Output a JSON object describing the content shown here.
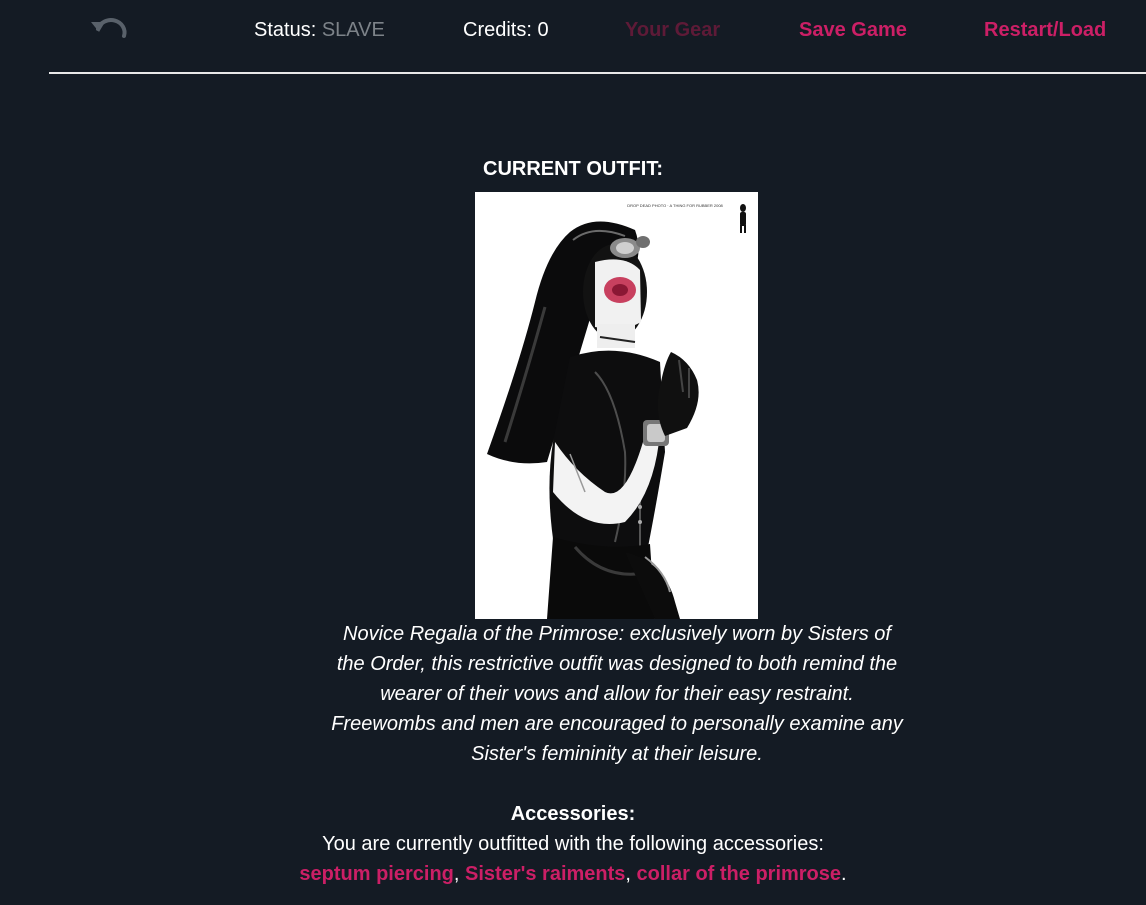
{
  "nav": {
    "undo_icon": "undo-arrow-icon",
    "status_label": "Status:",
    "status_value": "SLAVE",
    "credits_label": "Credits:",
    "credits_value": "0",
    "gear_link": "Your Gear",
    "save_link": "Save Game",
    "restart_link": "Restart/Load"
  },
  "outfit": {
    "heading": "CURRENT OUTFIT:",
    "photo_caption": "DROP DEAD PHOTO · A THING FOR RUBBER 2008",
    "description": "Novice Regalia of the Primrose: exclusively worn by Sisters of the Order, this restrictive outfit was designed to both remind the wearer of their vows and allow for their easy restraint. Freewombs and men are encouraged to personally examine any Sister's femininity at their leisure."
  },
  "accessories": {
    "heading": "Accessories:",
    "intro": "You are currently outfitted with the following accessories:",
    "items": [
      "septum piercing",
      "Sister's raiments",
      "collar of the primrose"
    ],
    "sep1": ", ",
    "sep2": ", ",
    "end": "."
  },
  "colors": {
    "background": "#141b24",
    "link": "#cc1f66",
    "link_dim": "#5e1a37",
    "muted": "#7d8389"
  }
}
